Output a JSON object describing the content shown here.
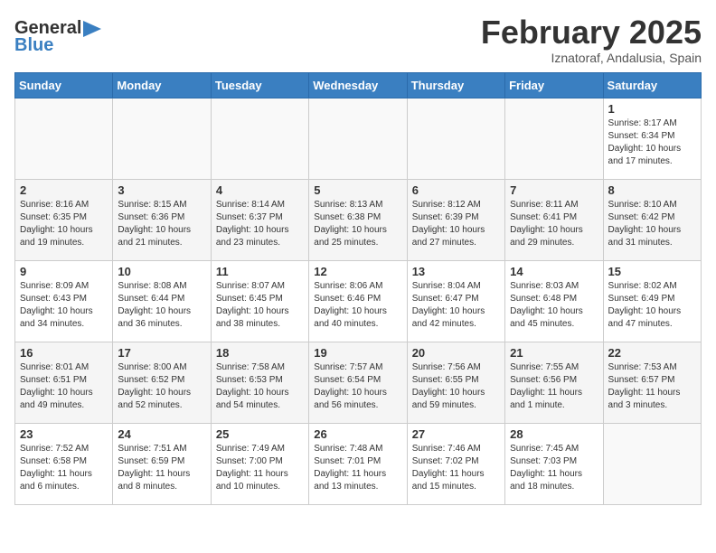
{
  "logo": {
    "line1": "General",
    "line2": "Blue"
  },
  "title": "February 2025",
  "subtitle": "Iznatoraf, Andalusia, Spain",
  "weekdays": [
    "Sunday",
    "Monday",
    "Tuesday",
    "Wednesday",
    "Thursday",
    "Friday",
    "Saturday"
  ],
  "weeks": [
    [
      {
        "day": "",
        "info": ""
      },
      {
        "day": "",
        "info": ""
      },
      {
        "day": "",
        "info": ""
      },
      {
        "day": "",
        "info": ""
      },
      {
        "day": "",
        "info": ""
      },
      {
        "day": "",
        "info": ""
      },
      {
        "day": "1",
        "info": "Sunrise: 8:17 AM\nSunset: 6:34 PM\nDaylight: 10 hours\nand 17 minutes."
      }
    ],
    [
      {
        "day": "2",
        "info": "Sunrise: 8:16 AM\nSunset: 6:35 PM\nDaylight: 10 hours\nand 19 minutes."
      },
      {
        "day": "3",
        "info": "Sunrise: 8:15 AM\nSunset: 6:36 PM\nDaylight: 10 hours\nand 21 minutes."
      },
      {
        "day": "4",
        "info": "Sunrise: 8:14 AM\nSunset: 6:37 PM\nDaylight: 10 hours\nand 23 minutes."
      },
      {
        "day": "5",
        "info": "Sunrise: 8:13 AM\nSunset: 6:38 PM\nDaylight: 10 hours\nand 25 minutes."
      },
      {
        "day": "6",
        "info": "Sunrise: 8:12 AM\nSunset: 6:39 PM\nDaylight: 10 hours\nand 27 minutes."
      },
      {
        "day": "7",
        "info": "Sunrise: 8:11 AM\nSunset: 6:41 PM\nDaylight: 10 hours\nand 29 minutes."
      },
      {
        "day": "8",
        "info": "Sunrise: 8:10 AM\nSunset: 6:42 PM\nDaylight: 10 hours\nand 31 minutes."
      }
    ],
    [
      {
        "day": "9",
        "info": "Sunrise: 8:09 AM\nSunset: 6:43 PM\nDaylight: 10 hours\nand 34 minutes."
      },
      {
        "day": "10",
        "info": "Sunrise: 8:08 AM\nSunset: 6:44 PM\nDaylight: 10 hours\nand 36 minutes."
      },
      {
        "day": "11",
        "info": "Sunrise: 8:07 AM\nSunset: 6:45 PM\nDaylight: 10 hours\nand 38 minutes."
      },
      {
        "day": "12",
        "info": "Sunrise: 8:06 AM\nSunset: 6:46 PM\nDaylight: 10 hours\nand 40 minutes."
      },
      {
        "day": "13",
        "info": "Sunrise: 8:04 AM\nSunset: 6:47 PM\nDaylight: 10 hours\nand 42 minutes."
      },
      {
        "day": "14",
        "info": "Sunrise: 8:03 AM\nSunset: 6:48 PM\nDaylight: 10 hours\nand 45 minutes."
      },
      {
        "day": "15",
        "info": "Sunrise: 8:02 AM\nSunset: 6:49 PM\nDaylight: 10 hours\nand 47 minutes."
      }
    ],
    [
      {
        "day": "16",
        "info": "Sunrise: 8:01 AM\nSunset: 6:51 PM\nDaylight: 10 hours\nand 49 minutes."
      },
      {
        "day": "17",
        "info": "Sunrise: 8:00 AM\nSunset: 6:52 PM\nDaylight: 10 hours\nand 52 minutes."
      },
      {
        "day": "18",
        "info": "Sunrise: 7:58 AM\nSunset: 6:53 PM\nDaylight: 10 hours\nand 54 minutes."
      },
      {
        "day": "19",
        "info": "Sunrise: 7:57 AM\nSunset: 6:54 PM\nDaylight: 10 hours\nand 56 minutes."
      },
      {
        "day": "20",
        "info": "Sunrise: 7:56 AM\nSunset: 6:55 PM\nDaylight: 10 hours\nand 59 minutes."
      },
      {
        "day": "21",
        "info": "Sunrise: 7:55 AM\nSunset: 6:56 PM\nDaylight: 11 hours\nand 1 minute."
      },
      {
        "day": "22",
        "info": "Sunrise: 7:53 AM\nSunset: 6:57 PM\nDaylight: 11 hours\nand 3 minutes."
      }
    ],
    [
      {
        "day": "23",
        "info": "Sunrise: 7:52 AM\nSunset: 6:58 PM\nDaylight: 11 hours\nand 6 minutes."
      },
      {
        "day": "24",
        "info": "Sunrise: 7:51 AM\nSunset: 6:59 PM\nDaylight: 11 hours\nand 8 minutes."
      },
      {
        "day": "25",
        "info": "Sunrise: 7:49 AM\nSunset: 7:00 PM\nDaylight: 11 hours\nand 10 minutes."
      },
      {
        "day": "26",
        "info": "Sunrise: 7:48 AM\nSunset: 7:01 PM\nDaylight: 11 hours\nand 13 minutes."
      },
      {
        "day": "27",
        "info": "Sunrise: 7:46 AM\nSunset: 7:02 PM\nDaylight: 11 hours\nand 15 minutes."
      },
      {
        "day": "28",
        "info": "Sunrise: 7:45 AM\nSunset: 7:03 PM\nDaylight: 11 hours\nand 18 minutes."
      },
      {
        "day": "",
        "info": ""
      }
    ]
  ]
}
